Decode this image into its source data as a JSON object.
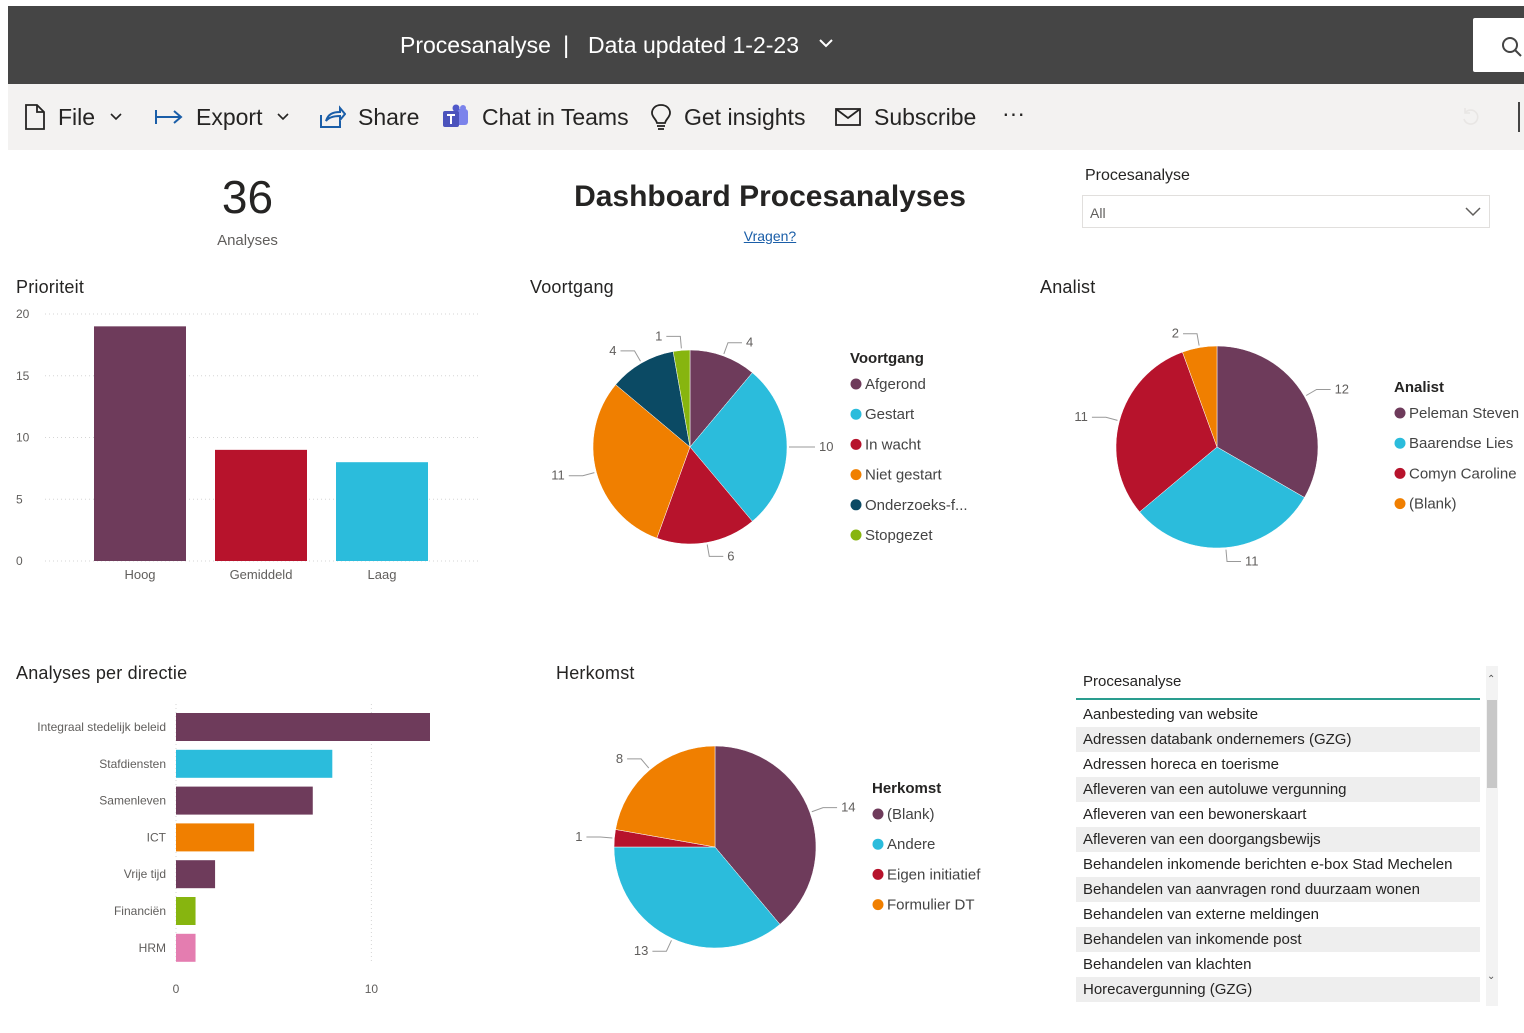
{
  "topbar": {
    "title": "Procesanalyse",
    "separator": "|",
    "updated": "Data updated 1-2-23"
  },
  "toolbar": {
    "file": "File",
    "export": "Export",
    "share": "Share",
    "teams": "Chat in Teams",
    "insights": "Get insights",
    "subscribe": "Subscribe",
    "more": "···"
  },
  "kpi": {
    "value": "36",
    "label": "Analyses"
  },
  "header": {
    "title": "Dashboard Procesanalyses",
    "link": "Vragen?"
  },
  "slicer": {
    "label": "Procesanalyse",
    "value": "All"
  },
  "colors": {
    "purple": "#6e3b5b",
    "cyan": "#2bbcdc",
    "red": "#b7132c",
    "orange": "#f07f00",
    "navy": "#0b4a64",
    "green": "#87b50f",
    "pink": "#e47db0"
  },
  "chart_data": [
    {
      "type": "bar",
      "title": "Prioriteit",
      "categories": [
        "Hoog",
        "Gemiddeld",
        "Laag"
      ],
      "values": [
        19,
        9,
        8
      ],
      "colors": [
        "#6e3b5b",
        "#b7132c",
        "#2bbcdc"
      ],
      "ylim": [
        0,
        20
      ],
      "yticks": [
        "0",
        "5",
        "10",
        "15",
        "20"
      ],
      "grid": true
    },
    {
      "type": "pie",
      "title": "Voortgang",
      "legend_title": "Voortgang",
      "labels": [
        "Afgerond",
        "Gestart",
        "In wacht",
        "Niet gestart",
        "Onderzoeks-f...",
        "Stopgezet"
      ],
      "values": [
        4,
        10,
        6,
        11,
        4,
        1
      ],
      "colors": [
        "#6e3b5b",
        "#2bbcdc",
        "#b7132c",
        "#f07f00",
        "#0b4a64",
        "#87b50f"
      ],
      "legend": "right"
    },
    {
      "type": "pie",
      "title": "Analist",
      "legend_title": "Analist",
      "labels": [
        "Peleman Steven",
        "Baarendse Lies",
        "Comyn Caroline",
        "(Blank)"
      ],
      "values": [
        12,
        11,
        11,
        2
      ],
      "colors": [
        "#6e3b5b",
        "#2bbcdc",
        "#b7132c",
        "#f07f00"
      ],
      "legend": "right"
    },
    {
      "type": "bar",
      "orientation": "horizontal",
      "title": "Analyses per directie",
      "categories": [
        "Integraal stedelijk beleid",
        "Stafdiensten",
        "Samenleven",
        "ICT",
        "Vrije tijd",
        "Financiën",
        "HRM"
      ],
      "values": [
        13,
        8,
        7,
        4,
        2,
        1,
        1
      ],
      "colors": [
        "#6e3b5b",
        "#2bbcdc",
        "#6e3b5b",
        "#f07f00",
        "#6e3b5b",
        "#87b50f",
        "#e47db0"
      ],
      "xlim": [
        0,
        13
      ],
      "xticks": [
        "0",
        "10"
      ],
      "grid": true
    },
    {
      "type": "pie",
      "title": "Herkomst",
      "legend_title": "Herkomst",
      "labels": [
        "(Blank)",
        "Andere",
        "Eigen initiatief",
        "Formulier DT"
      ],
      "values": [
        14,
        13,
        1,
        8
      ],
      "colors": [
        "#6e3b5b",
        "#2bbcdc",
        "#b7132c",
        "#f07f00"
      ],
      "legend": "right"
    },
    {
      "type": "table",
      "header": "Procesanalyse",
      "rows": [
        "Aanbesteding van website",
        "Adressen databank ondernemers (GZG)",
        "Adressen horeca en toerisme",
        "Afleveren van een autoluwe vergunning",
        "Afleveren van een bewonerskaart",
        "Afleveren van een doorgangsbewijs",
        "Behandelen inkomende berichten e-box Stad Mechelen",
        "Behandelen van aanvragen rond duurzaam wonen",
        "Behandelen van externe meldingen",
        "Behandelen van inkomende post",
        "Behandelen van klachten",
        "Horecavergunning (GZG)"
      ]
    }
  ]
}
